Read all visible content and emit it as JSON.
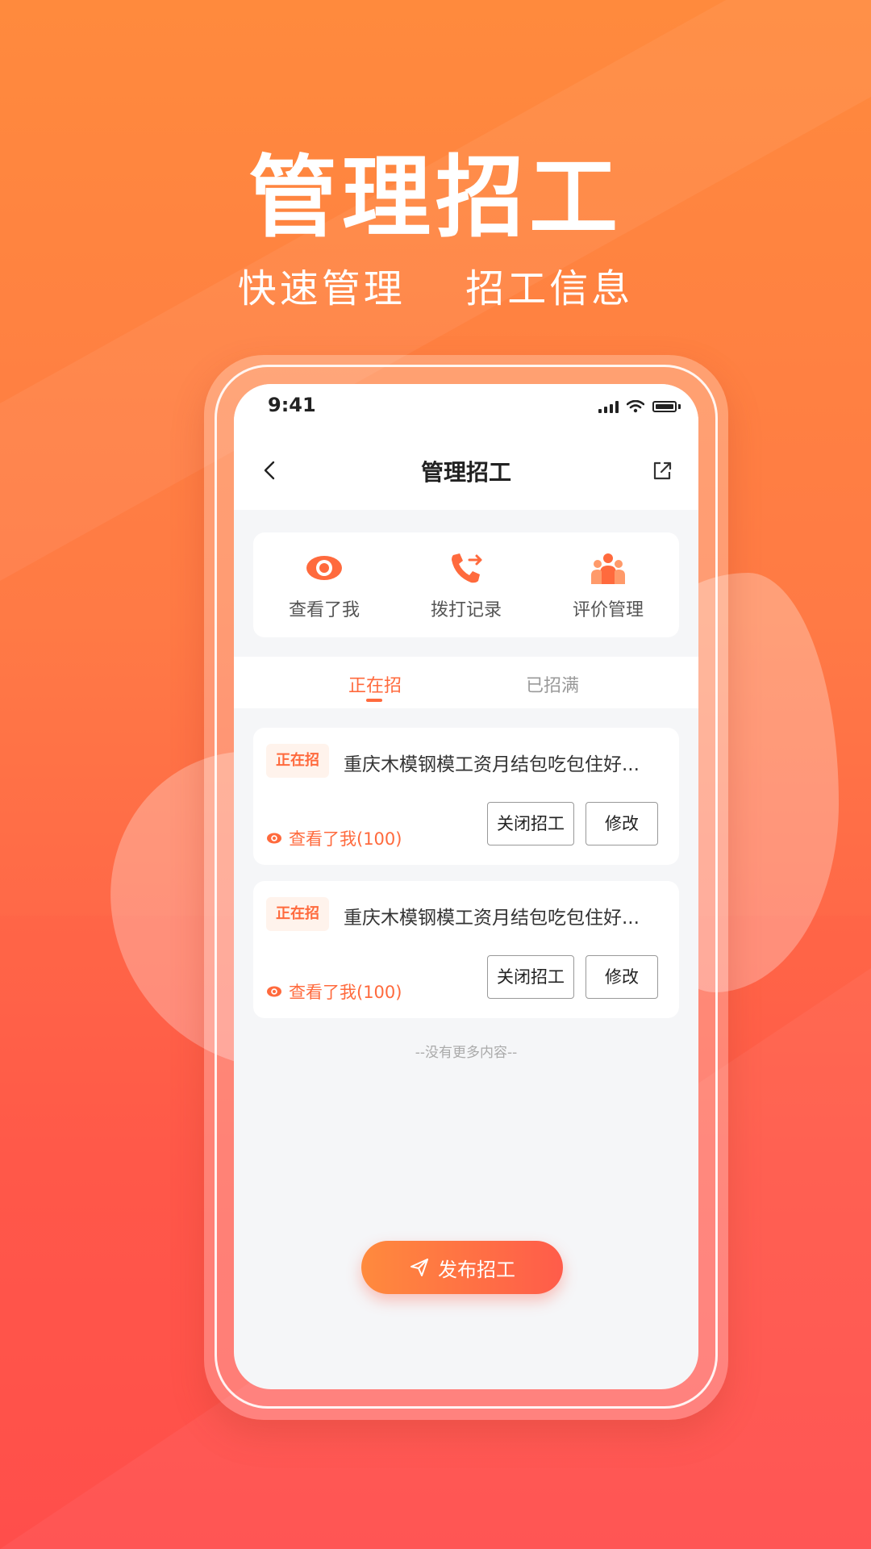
{
  "hero": {
    "title": "管理招工",
    "subtitle": "快速管理  招工信息"
  },
  "status_bar": {
    "time": "9:41",
    "icons": [
      "signal-icon",
      "wifi-icon",
      "battery-icon"
    ]
  },
  "nav": {
    "title": "管理招工",
    "back_icon": "chevron-left-icon",
    "share_icon": "share-icon"
  },
  "quick_actions": [
    {
      "label": "查看了我",
      "icon": "eye-icon"
    },
    {
      "label": "拨打记录",
      "icon": "phone-call-icon"
    },
    {
      "label": "评价管理",
      "icon": "people-icon"
    }
  ],
  "tabs": [
    {
      "label": "正在招",
      "active": true
    },
    {
      "label": "已招满",
      "active": false
    }
  ],
  "jobs": [
    {
      "status": "正在招",
      "title": "重庆木模钢模工资月结包吃包住好...",
      "views_label": "查看了我(100)",
      "close_label": "关闭招工",
      "edit_label": "修改"
    },
    {
      "status": "正在招",
      "title": "重庆木模钢模工资月结包吃包住好...",
      "views_label": "查看了我(100)",
      "close_label": "关闭招工",
      "edit_label": "修改"
    }
  ],
  "footer": {
    "no_more": "--没有更多内容--",
    "publish_label": "发布招工",
    "publish_icon": "send-icon"
  },
  "colors": {
    "accent": "#ff6a3d",
    "background_top": "#ff8a3d",
    "background_bottom": "#ff4f4c"
  }
}
